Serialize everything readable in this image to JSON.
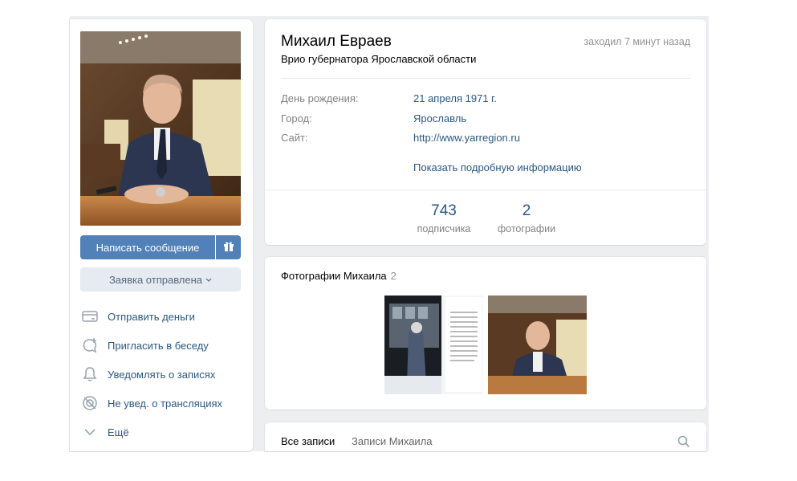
{
  "profile": {
    "name": "Михаил Евраев",
    "status": "Врио губернатора Ярославской области",
    "last_seen": "заходил 7 минут назад",
    "info": [
      {
        "key": "День рождения:",
        "value": "21 апреля 1971 г."
      },
      {
        "key": "Город:",
        "value": "Ярославль"
      },
      {
        "key": "Сайт:",
        "value": "http://www.yarregion.ru"
      }
    ],
    "show_more": "Показать подробную информацию",
    "counters": [
      {
        "number": "743",
        "caption": "подписчика"
      },
      {
        "number": "2",
        "caption": "фотографии"
      }
    ]
  },
  "sidebar": {
    "message_button": "Написать сообщение",
    "request_button": "Заявка отправлена",
    "actions": [
      {
        "label": "Отправить деньги",
        "icon": "card-icon"
      },
      {
        "label": "Пригласить в беседу",
        "icon": "chat-add-icon"
      },
      {
        "label": "Уведомлять о записях",
        "icon": "bell-icon"
      },
      {
        "label": "Не увед. о трансляциях",
        "icon": "broadcast-off-icon"
      },
      {
        "label": "Ещё",
        "icon": "chevron-down-icon"
      }
    ]
  },
  "photos": {
    "title": "Фотографии Михаила",
    "count": "2"
  },
  "wall": {
    "tabs": [
      "Все записи",
      "Записи Михаила"
    ]
  },
  "colors": {
    "accent": "#5181b8",
    "link": "#2a5885",
    "muted": "#828282"
  }
}
